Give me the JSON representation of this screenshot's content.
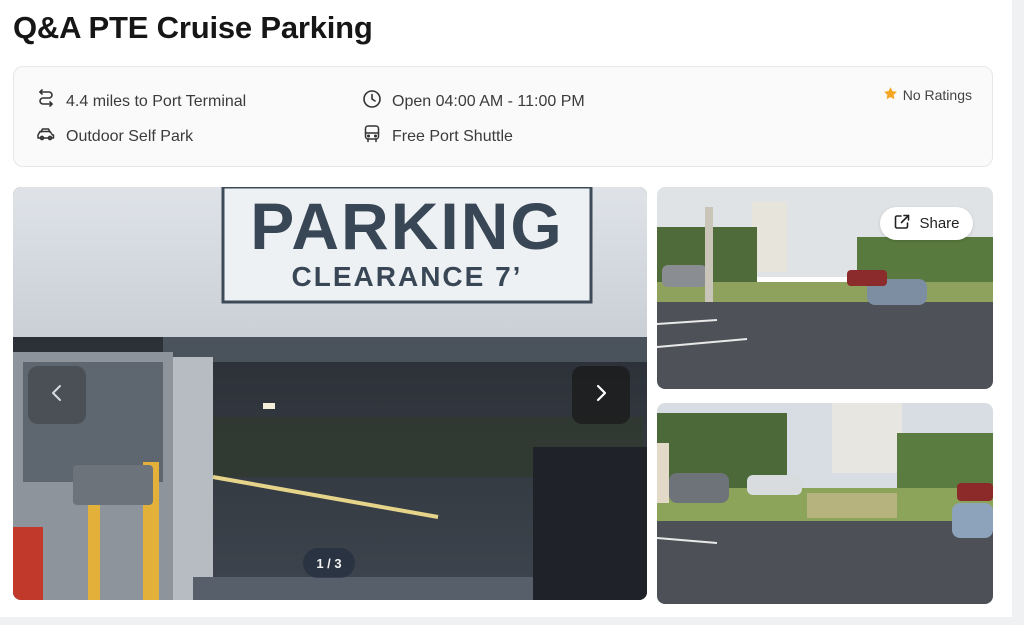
{
  "title": "Q&A PTE Cruise Parking",
  "info": {
    "distance": "4.4 miles to Port Terminal",
    "hours": "Open 04:00 AM - 11:00 PM",
    "park_type": "Outdoor Self Park",
    "shuttle": "Free Port Shuttle",
    "rating": "No Ratings"
  },
  "icons": {
    "distance": "route-icon",
    "hours": "clock-icon",
    "park_type": "car-icon",
    "shuttle": "bus-icon",
    "rating": "star-icon",
    "share": "share-icon",
    "prev": "chevron-left-icon",
    "next": "chevron-right-icon"
  },
  "gallery": {
    "counter": "1 / 3",
    "share_label": "Share",
    "main_sign_line1": "PARKING",
    "main_sign_line2": "CLEARANCE 7’",
    "side_photos_count_visible": 2
  },
  "colors": {
    "star": "#f5a623",
    "card_bg": "#fafafa",
    "card_border": "#e6e7ea"
  }
}
